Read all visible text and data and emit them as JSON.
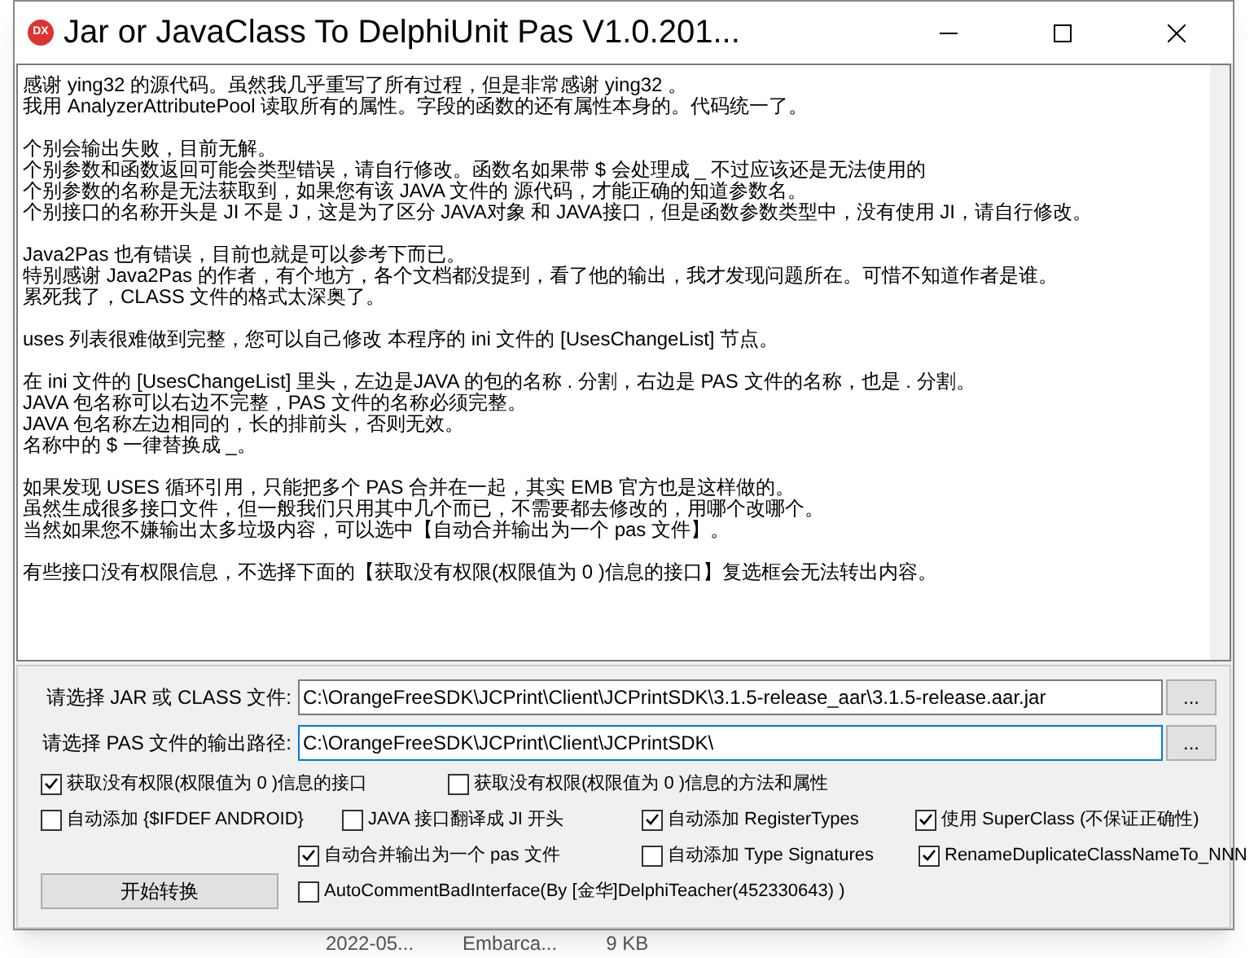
{
  "window": {
    "title": "Jar or JavaClass To DelphiUnit Pas V1.0.201...",
    "app_icon_text": "DX"
  },
  "notes": [
    [
      "感谢 ying32 的源代码。虽然我几乎重写了所有过程，但是非常感谢 ying32 。",
      "我用 AnalyzerAttributePool 读取所有的属性。字段的函数的还有属性本身的。代码统一了。"
    ],
    [
      "个别会输出失败，目前无解。",
      "个别参数和函数返回可能会类型错误，请自行修改。函数名如果带 $ 会处理成 _ 不过应该还是无法使用的",
      "个别参数的名称是无法获取到，如果您有该 JAVA 文件的 源代码，才能正确的知道参数名。",
      "个别接口的名称开头是 JI 不是 J，这是为了区分 JAVA对象 和 JAVA接口，但是函数参数类型中，没有使用 JI，请自行修改。"
    ],
    [
      "Java2Pas 也有错误，目前也就是可以参考下而已。",
      "特别感谢 Java2Pas 的作者，有个地方，各个文档都没提到，看了他的输出，我才发现问题所在。可惜不知道作者是谁。",
      "累死我了，CLASS 文件的格式太深奥了。"
    ],
    [
      "uses 列表很难做到完整，您可以自己修改 本程序的 ini 文件的 [UsesChangeList] 节点。"
    ],
    [
      "在 ini 文件的 [UsesChangeList] 里头，左边是JAVA 的包的名称 . 分割，右边是 PAS 文件的名称，也是 . 分割。",
      "JAVA 包名称可以右边不完整，PAS 文件的名称必须完整。",
      "JAVA 包名称左边相同的，长的排前头，否则无效。",
      "名称中的 $ 一律替换成 _。"
    ],
    [
      "如果发现 USES 循环引用，只能把多个 PAS 合并在一起，其实 EMB 官方也是这样做的。",
      "虽然生成很多接口文件，但一般我们只用其中几个而已，不需要都去修改的，用哪个改哪个。",
      "当然如果您不嫌输出太多垃圾内容，可以选中【自动合并输出为一个 pas 文件】。"
    ],
    [
      "有些接口没有权限信息，不选择下面的【获取没有权限(权限值为 0 )信息的接口】复选框会无法转出内容。"
    ]
  ],
  "fields": [
    {
      "label": "请选择 JAR 或 CLASS 文件:",
      "value": "C:\\OrangeFreeSDK\\JCPrint\\Client\\JCPrintSDK\\3.1.5-release_aar\\3.1.5-release.aar.jar",
      "focused": false,
      "browse": "..."
    },
    {
      "label": "请选择 PAS 文件的输出路径:",
      "value": "C:\\OrangeFreeSDK\\JCPrint\\Client\\JCPrintSDK\\",
      "focused": true,
      "browse": "..."
    }
  ],
  "option_rows": [
    [
      {
        "label": "获取没有权限(权限值为 0 )信息的接口",
        "checked": true
      },
      {
        "label": "获取没有权限(权限值为 0 )信息的方法和属性",
        "checked": false
      }
    ],
    [
      {
        "label": "自动添加 {$IFDEF ANDROID}",
        "checked": false
      },
      {
        "label": "JAVA 接口翻译成 JI 开头",
        "checked": false
      },
      {
        "label": "自动添加 RegisterTypes",
        "checked": true
      },
      {
        "label": "使用 SuperClass (不保证正确性)",
        "checked": true
      }
    ],
    [
      {
        "label": "自动合并输出为一个 pas 文件",
        "checked": true
      },
      {
        "label": "自动添加 Type Signatures",
        "checked": false
      },
      {
        "label": "RenameDuplicateClassNameTo_NNN",
        "checked": true
      }
    ],
    [
      {
        "label": "AutoCommentBadInterface(By [金华]DelphiTeacher(452330643) )",
        "checked": false
      }
    ]
  ],
  "start_button": "开始转换",
  "background_listing": [
    "2022-05...",
    "Embarca...",
    "9 KB"
  ]
}
